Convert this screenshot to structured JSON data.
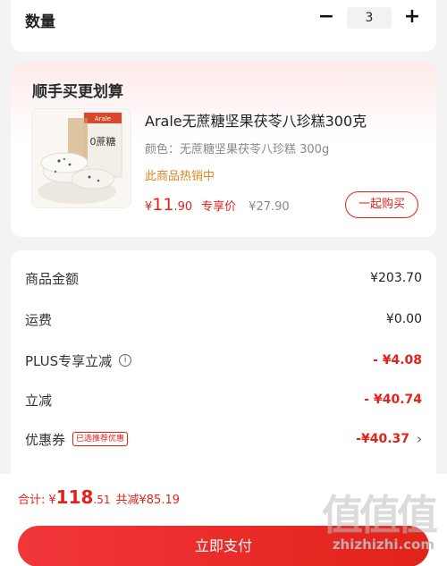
{
  "quantity": {
    "label": "数量",
    "minus": "−",
    "value": "3",
    "plus": "+"
  },
  "bundle": {
    "title": "顺手买更划算",
    "product": {
      "name": "Arale无蔗糖坚果茯苓八珍糕300克",
      "spec": "颜色：无蔗糖坚果茯苓八珍糕 300g",
      "hot": "此商品热销中",
      "price_symbol": "¥",
      "price_int": "11",
      "price_dec": ".90",
      "price_tag": "专享价",
      "orig_price": "¥27.90",
      "buy_label": "一起购买",
      "image_brand": "Arale",
      "image_text": "0蔗糖"
    }
  },
  "fees": [
    {
      "label": "商品金额",
      "value": "¥203.70",
      "red": false,
      "icon": null,
      "badge": null
    },
    {
      "label": "运费",
      "value": "¥0.00",
      "red": false,
      "icon": null,
      "badge": null
    },
    {
      "label": "PLUS专享立减",
      "value": "- ¥4.08",
      "red": true,
      "icon": "info-icon",
      "badge": null
    },
    {
      "label": "立减",
      "value": "- ¥40.74",
      "red": true,
      "icon": null,
      "badge": null
    },
    {
      "label": "优惠券",
      "value": "-¥40.37",
      "red": true,
      "icon": null,
      "badge": "已选推荐优惠"
    }
  ],
  "total": {
    "label": "合计:",
    "symbol": "¥",
    "int": "118",
    "dec": ".51",
    "saved": "共减¥85.19"
  },
  "pay_button": "立即支付",
  "watermark": {
    "glyphs": "值值值",
    "text": "zhizhizhi.com"
  },
  "colors": {
    "accent": "#e2231a",
    "hot": "#e0861c"
  }
}
